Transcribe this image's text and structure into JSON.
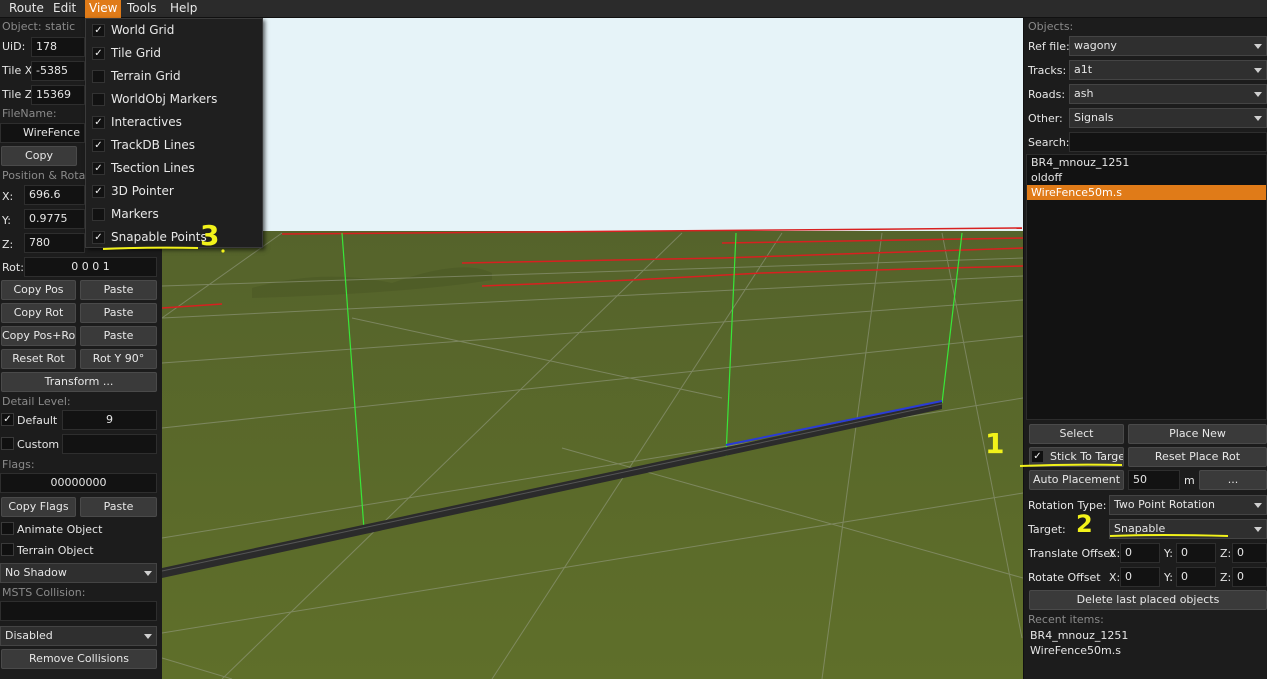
{
  "menubar": {
    "items": [
      "Route",
      "Edit",
      "View",
      "Tools",
      "Help"
    ]
  },
  "view_menu": {
    "items": [
      {
        "label": "World Grid",
        "checked": true
      },
      {
        "label": "Tile Grid",
        "checked": true
      },
      {
        "label": "Terrain Grid",
        "checked": false
      },
      {
        "label": "WorldObj Markers",
        "checked": false
      },
      {
        "label": "Interactives",
        "checked": true
      },
      {
        "label": "TrackDB Lines",
        "checked": true
      },
      {
        "label": "Tsection Lines",
        "checked": true
      },
      {
        "label": "3D Pointer",
        "checked": true
      },
      {
        "label": "Markers",
        "checked": false
      },
      {
        "label": "Snapable Points",
        "checked": true
      }
    ]
  },
  "left": {
    "object_header": "Object: static",
    "uid_label": "UiD:",
    "uid": "178",
    "tilex_label": "Tile X:",
    "tilex": "-5385",
    "tilez_label": "Tile Z:",
    "tilez": "15369",
    "filename_label": "FileName:",
    "filename": "WireFence",
    "copy": "Copy",
    "pos_header": "Position & Rotatio",
    "x_label": "X:",
    "x": "696.6",
    "y_label": "Y:",
    "y": "0.9775",
    "z_label": "Z:",
    "z": "780",
    "rot_label": "Rot:",
    "rot": "0 0 0 1",
    "copy_pos": "Copy Pos",
    "paste1": "Paste",
    "copy_rot": "Copy Rot",
    "paste2": "Paste",
    "copy_pos_rot": "Copy Pos+Rot",
    "paste3": "Paste",
    "reset_rot": "Reset Rot",
    "rot_y90": "Rot Y 90°",
    "transform": "Transform ...",
    "detail_header": "Detail Level:",
    "default_label": "Default",
    "default_checked": "✓",
    "default_value": "9",
    "custom_label": "Custom",
    "flags_header": "Flags:",
    "flags": "00000000",
    "copy_flags": "Copy Flags",
    "paste4": "Paste",
    "animate": "Animate Object",
    "terrain": "Terrain Object",
    "shadow": "No Shadow",
    "msts_header": "MSTS Collision:",
    "collision_mode": "Disabled",
    "remove_collisions": "Remove Collisions"
  },
  "right": {
    "objects_header": "Objects:",
    "ref_label": "Ref file:",
    "ref": "wagony",
    "tracks_label": "Tracks:",
    "tracks": "a1t",
    "roads_label": "Roads:",
    "roads": "ash",
    "other_label": "Other:",
    "other": "Signals",
    "search_label": "Search:",
    "search_value": "",
    "list": [
      "BR4_mnouz_1251",
      "oldoff",
      "WireFence50m.s"
    ],
    "selected_index": 2,
    "select": "Select",
    "place_new": "Place New",
    "stick_to_target": "Stick To Target",
    "stick_checked": "✓",
    "reset_place_rot": "Reset Place Rot",
    "auto_placement": "Auto Placement",
    "auto_value": "50",
    "auto_unit": "m",
    "dots": "...",
    "rotation_type_label": "Rotation Type:",
    "rotation_type": "Two Point Rotation",
    "target_label": "Target:",
    "target": "Snapable",
    "translate_label": "Translate Offset",
    "tx_label": "X:",
    "tx": "0",
    "ty_label": "Y:",
    "ty": "0",
    "tz_label": "Z:",
    "tz": "0",
    "rotate_label": "Rotate Offset",
    "rx_label": "X:",
    "rx": "0",
    "ry_label": "Y:",
    "ry": "0",
    "rz_label": "Z:",
    "rz": "0",
    "delete_last": "Delete last placed objects",
    "recent_header": "Recent items:",
    "recent": [
      "BR4_mnouz_1251",
      "WireFence50m.s"
    ]
  },
  "annotations": {
    "a1": "1",
    "a2": "2",
    "a3": "3"
  },
  "colors": {
    "accent": "#e07b18",
    "annotation": "#f2f21a",
    "sky": "#e6f3f8",
    "ground": "#5b6b2a",
    "pointer": "#39e639",
    "fence_track": "#2a3bd6"
  }
}
